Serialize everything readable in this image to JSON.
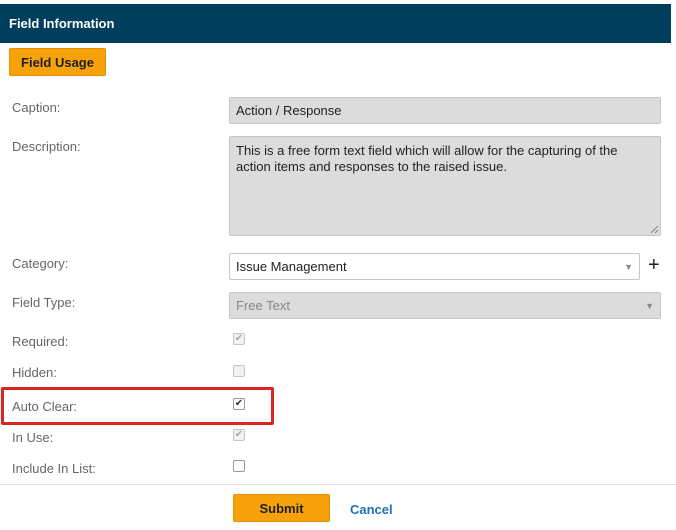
{
  "header": {
    "title": "Field Information"
  },
  "buttons": {
    "field_usage": "Field Usage",
    "submit": "Submit",
    "cancel": "Cancel"
  },
  "fields": {
    "caption": {
      "label": "Caption:",
      "value": "Action / Response"
    },
    "description": {
      "label": "Description:",
      "value": "This is a free form text field which will allow for the capturing of the action items and responses to the raised issue."
    },
    "category": {
      "label": "Category:",
      "value": "Issue Management"
    },
    "field_type": {
      "label": "Field Type:",
      "value": "Free Text"
    },
    "required": {
      "label": "Required:",
      "checked": true,
      "disabled": true
    },
    "hidden": {
      "label": "Hidden:",
      "checked": false,
      "disabled": true
    },
    "auto_clear": {
      "label": "Auto Clear:",
      "checked": true,
      "disabled": false
    },
    "in_use": {
      "label": "In Use:",
      "checked": true,
      "disabled": true
    },
    "include_in_list": {
      "label": "Include In List:",
      "checked": false,
      "disabled": false
    }
  },
  "colors": {
    "header_bg": "#003f5c",
    "accent": "#f7a20b",
    "highlight": "#d9241f",
    "link": "#1e6fb3"
  }
}
